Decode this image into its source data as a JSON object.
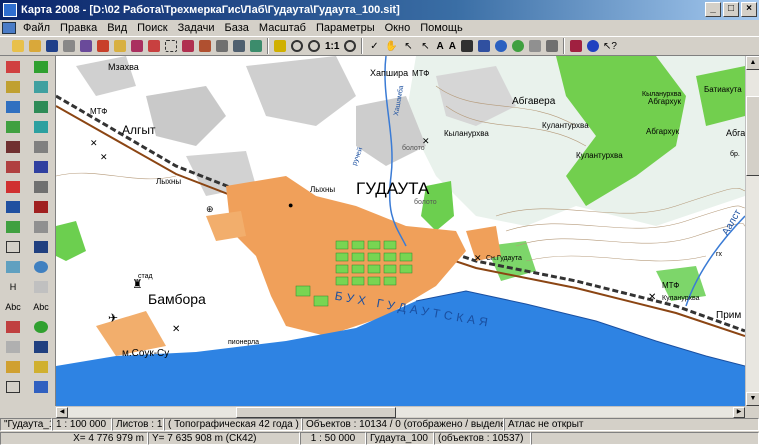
{
  "window": {
    "title": "Карта 2008 - [D:\\02 Работа\\ТрехмеркаГис\\Лаб\\Гудаута\\Гудаута_100.sit]"
  },
  "menu": [
    "Файл",
    "Правка",
    "Вид",
    "Поиск",
    "Задачи",
    "База",
    "Масштаб",
    "Параметры",
    "Окно",
    "Помощь"
  ],
  "toolbar": {
    "scale_button": "1:1",
    "text_tool_1": "A",
    "text_tool_2": "A"
  },
  "lefttools": {
    "text_tool_label": "Abc",
    "text_tool_label_2": "Abc",
    "height_tool_label": "H"
  },
  "map": {
    "labels": {
      "city": "ГУДАУТА",
      "bambora": "Бамбора",
      "algyt": "Алгыт",
      "mzahva": "Мзахва",
      "hapshira": "Хапшира",
      "abgavera": "Абгавера",
      "kulanurhva_1": "Кыланурхва",
      "kulanurhva_2": "Кулантурхва",
      "kulanurhva_3": "Кулантурхва",
      "abgarhuk_1": "Абгархук",
      "abgarhuk_2": "Абгархук",
      "batikuta": "Батиакута",
      "abga": "Абга",
      "bay": "БУХ ГУДАУТСКАЯ",
      "souk_su": "м.Соук-Су",
      "lyhny_1": "Лыхны",
      "lyhny_2": "Лыхны",
      "mtf_1": "МТФ",
      "mtf_2": "МТФ",
      "mtf_3": "МТФ",
      "stad": "стад",
      "pioner": "пионерла",
      "prim": "Прим",
      "aalst": "Аалст",
      "bolota": "болото",
      "bolota_2": "болото",
      "sn_gudauta": "Сн.Гудаута",
      "kulanurhva_low": "Куланурхва",
      "kulanurhva_low2": "Кыланурхва",
      "river_1": "Хашамба",
      "river_2": "ручей",
      "br": "бр.",
      "gh": "гх"
    }
  },
  "status": {
    "map_name": "\"Гудаута_100\"",
    "scale": "1 : 100 000",
    "sheets": "Листов : 1",
    "projection": "( Топографическая 42 года )",
    "objects": "Объектов : 10134 / 0 (отображено / выделено)",
    "atlas": "Атлас не открыт",
    "x_label": "X=",
    "x_value": "4 776 979 m",
    "y_label": "Y=",
    "y_value": "7 635 908 m (СК42)",
    "scale2": "1 : 50 000",
    "layer": "Гудаута_100",
    "layer_objects": "(объектов : 10537)"
  },
  "colors": {
    "sea": "#2e83e3",
    "urban": "#f0a05a",
    "forest": "#6ccf4f",
    "relief": "#a7c8b0",
    "hills": "#c8c8c8"
  }
}
